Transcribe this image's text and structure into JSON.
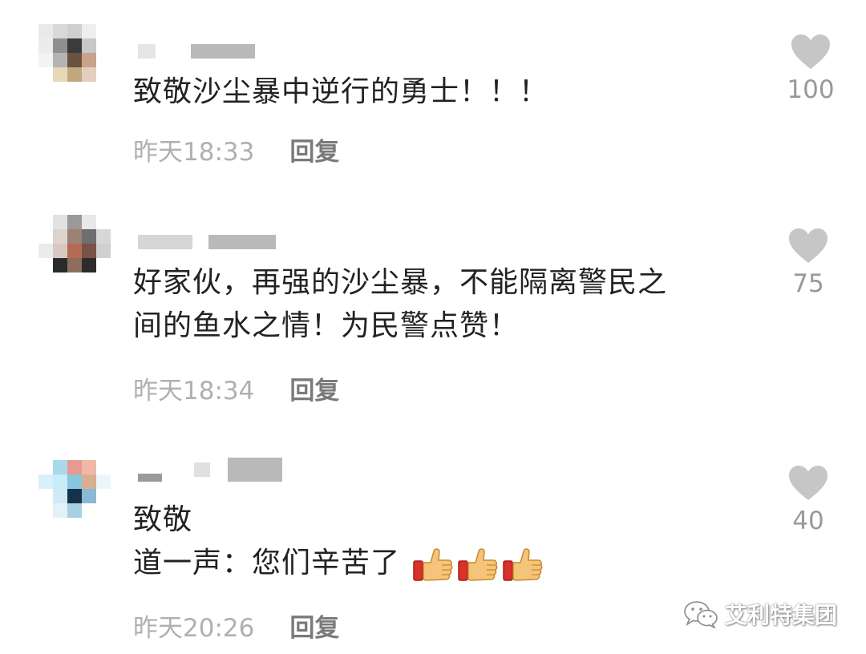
{
  "comments": [
    {
      "text_lines": [
        "致敬沙尘暴中逆行的勇士！！！"
      ],
      "time": "昨天18:33",
      "reply_label": "回复",
      "like_count": "100",
      "like_icon": "heart-icon"
    },
    {
      "text_lines": [
        "好家伙，再强的沙尘暴，不能隔离警民之",
        "间的鱼水之情！为民警点赞！"
      ],
      "time": "昨天18:34",
      "reply_label": "回复",
      "like_count": "75",
      "like_icon": "heart-icon"
    },
    {
      "text_lines": [
        "致敬",
        "道一声：您们辛苦了"
      ],
      "emoji": [
        "thumbs-up-icon",
        "thumbs-up-icon",
        "thumbs-up-icon"
      ],
      "time": "昨天20:26",
      "reply_label": "回复",
      "like_count": "40",
      "like_icon": "heart-icon"
    }
  ],
  "watermark": {
    "text": "艾利特集团",
    "icon": "wechat-icon"
  },
  "colors": {
    "text": "#222222",
    "time": "#b0b0b0",
    "reply": "#7a7a7a",
    "heart": "#c6c6c6",
    "count": "#999999"
  }
}
